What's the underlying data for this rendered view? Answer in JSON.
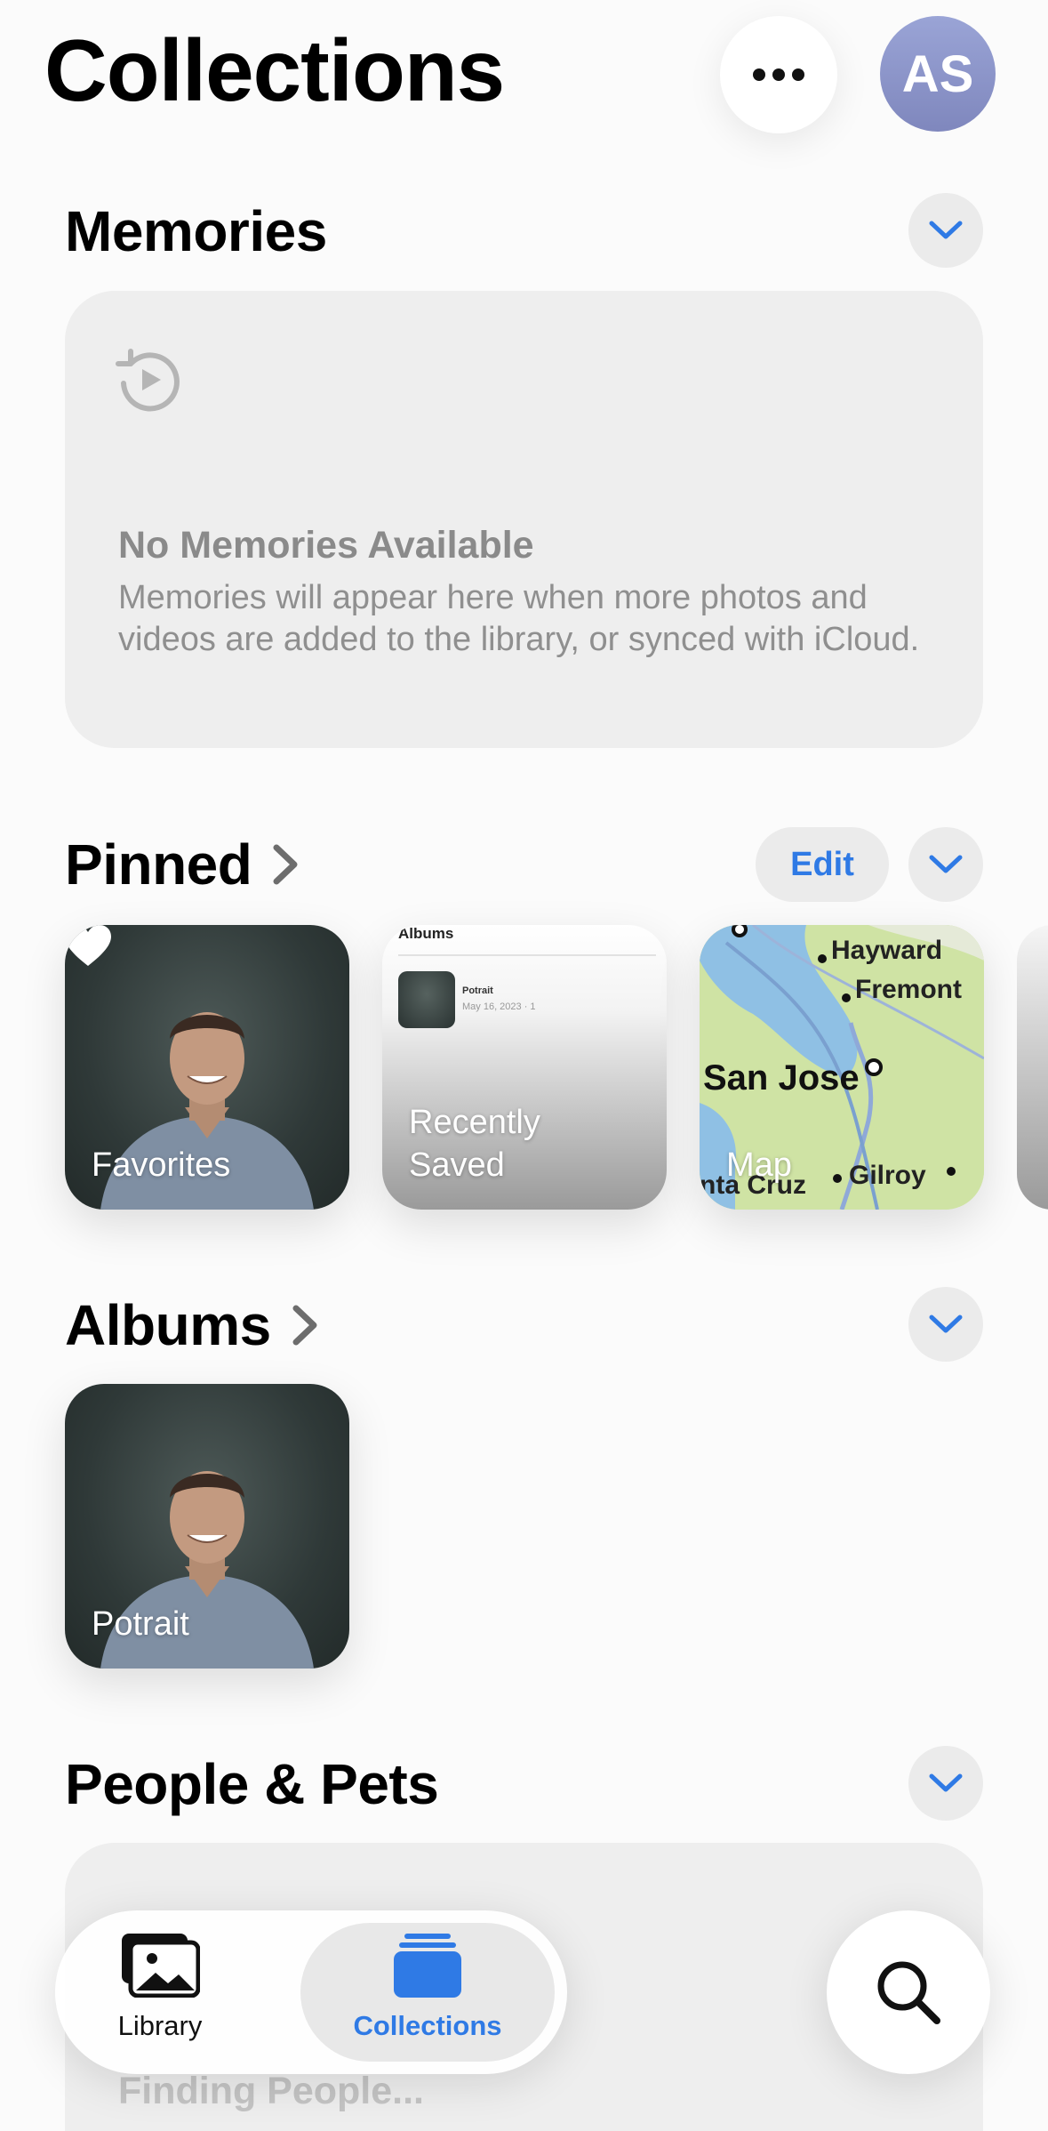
{
  "header": {
    "title": "Collections",
    "more_icon": "ellipsis-icon",
    "avatar_initials": "AS"
  },
  "sections": {
    "memories": {
      "title": "Memories",
      "empty_icon": "memories-icon",
      "empty_title": "No Memories Available",
      "empty_text": "Memories will appear here when more photos and videos are added to the library, or synced with iCloud."
    },
    "pinned": {
      "title": "Pinned",
      "edit_label": "Edit",
      "tiles": [
        {
          "label": "Favorites",
          "icon": "heart-icon"
        },
        {
          "label": "Recently Saved",
          "preview_header": "Albums",
          "preview_item": "Potrait",
          "preview_date": "May 16, 2023 · 1"
        },
        {
          "label": "Map",
          "places": [
            "Hayward",
            "Fremont",
            "San Jose",
            "nta Cruz",
            "Gilroy"
          ]
        }
      ]
    },
    "albums": {
      "title": "Albums",
      "items": [
        {
          "label": "Potrait"
        }
      ]
    },
    "people": {
      "title": "People & Pets",
      "finding_title": "Finding People..."
    }
  },
  "tabbar": {
    "tabs": [
      {
        "label": "Library",
        "icon": "photo-library-icon",
        "selected": false
      },
      {
        "label": "Collections",
        "icon": "collections-stack-icon",
        "selected": true
      }
    ]
  },
  "search_icon": "magnifier-icon",
  "colors": {
    "accent": "#2f7ae5",
    "background": "#fbfbfb",
    "card": "#eeeeee",
    "avatar": "#8c94c9"
  }
}
